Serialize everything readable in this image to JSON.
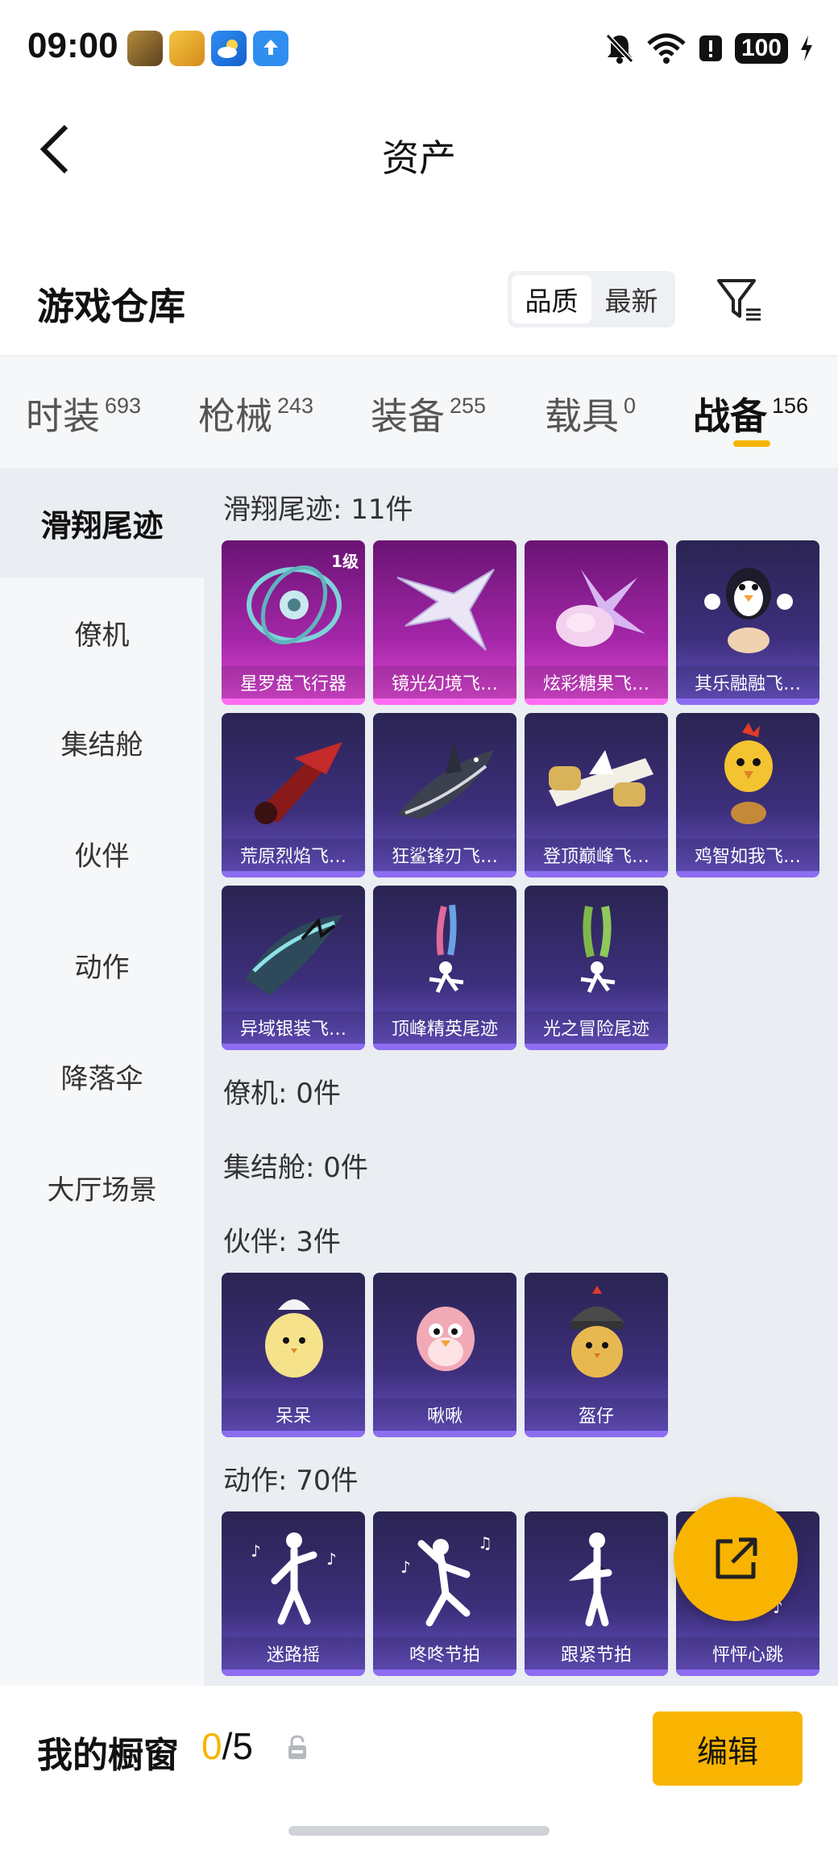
{
  "status_bar": {
    "time": "09:00",
    "battery": "100",
    "app_icons": [
      "pubg-app-icon",
      "peace-elite-app-icon",
      "weather-app-icon",
      "update-app-icon"
    ]
  },
  "header": {
    "title": "资产"
  },
  "warehouse": {
    "title": "游戏仓库",
    "sort_options": [
      "品质",
      "最新"
    ],
    "sort_selected": "品质"
  },
  "tabs": [
    {
      "label": "时装",
      "count": "693"
    },
    {
      "label": "枪械",
      "count": "243"
    },
    {
      "label": "装备",
      "count": "255"
    },
    {
      "label": "载具",
      "count": "0"
    },
    {
      "label": "战备",
      "count": "156",
      "active": true
    }
  ],
  "sidebar": {
    "items": [
      "滑翔尾迹",
      "僚机",
      "集结舱",
      "伙伴",
      "动作",
      "降落伞",
      "大厅场景"
    ],
    "active": "滑翔尾迹"
  },
  "sections": {
    "glide": {
      "title": "滑翔尾迹: 11件",
      "items": [
        {
          "label": "星罗盘飞行器",
          "rarity": "pink",
          "badge": "1级"
        },
        {
          "label": "镜光幻境飞…",
          "rarity": "pink"
        },
        {
          "label": "炫彩糖果飞…",
          "rarity": "pink"
        },
        {
          "label": "其乐融融飞…",
          "rarity": "purple"
        },
        {
          "label": "荒原烈焰飞…",
          "rarity": "purple"
        },
        {
          "label": "狂鲨锋刃飞…",
          "rarity": "purple"
        },
        {
          "label": "登顶巅峰飞…",
          "rarity": "purple"
        },
        {
          "label": "鸡智如我飞…",
          "rarity": "purple"
        },
        {
          "label": "异域银装飞…",
          "rarity": "purple"
        },
        {
          "label": "顶峰精英尾迹",
          "rarity": "purple"
        },
        {
          "label": "光之冒险尾迹",
          "rarity": "purple"
        }
      ]
    },
    "wingman": {
      "title": "僚机: 0件"
    },
    "pod": {
      "title": "集结舱: 0件"
    },
    "partner": {
      "title": "伙伴: 3件",
      "items": [
        {
          "label": "呆呆",
          "rarity": "purple"
        },
        {
          "label": "啾啾",
          "rarity": "purple"
        },
        {
          "label": "盔仔",
          "rarity": "purple"
        }
      ]
    },
    "emote": {
      "title": "动作: 70件",
      "items": [
        {
          "label": "迷路摇",
          "rarity": "purple"
        },
        {
          "label": "咚咚节拍",
          "rarity": "purple"
        },
        {
          "label": "跟紧节拍",
          "rarity": "purple"
        },
        {
          "label": "怦怦心跳",
          "rarity": "purple"
        }
      ]
    }
  },
  "showcase": {
    "title": "我的橱窗",
    "current": "0",
    "total": "/5",
    "edit_label": "编辑"
  },
  "colors": {
    "accent": "#f8b400",
    "purple_card": "#3d2f7c",
    "pink_card": "#a426a8"
  }
}
